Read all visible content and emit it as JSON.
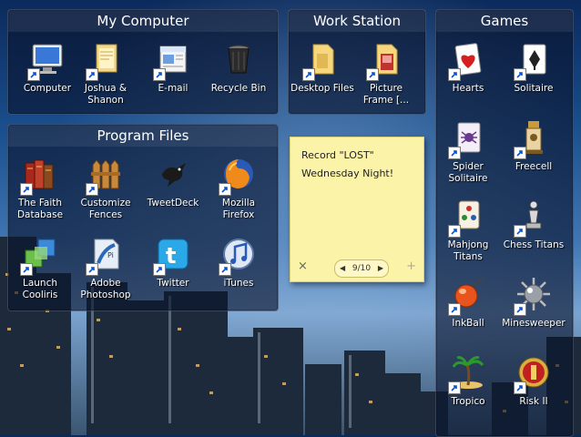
{
  "fences": {
    "my_computer": {
      "title": "My Computer",
      "items": [
        {
          "label": "Computer",
          "icon": "computer-icon"
        },
        {
          "label": "Joshua & Shanon",
          "icon": "user-folder-icon"
        },
        {
          "label": "E-mail",
          "icon": "email-icon"
        },
        {
          "label": "Recycle Bin",
          "icon": "recycle-bin-icon"
        }
      ]
    },
    "work_station": {
      "title": "Work Station",
      "items": [
        {
          "label": "Desktop Files",
          "icon": "folder-icon"
        },
        {
          "label": "Picture Frame [...",
          "icon": "picture-folder-icon"
        }
      ]
    },
    "games": {
      "title": "Games",
      "items": [
        {
          "label": "Hearts",
          "icon": "hearts-icon"
        },
        {
          "label": "Solitaire",
          "icon": "solitaire-icon"
        },
        {
          "label": "Spider Solitaire",
          "icon": "spider-solitaire-icon"
        },
        {
          "label": "Freecell",
          "icon": "freecell-icon"
        },
        {
          "label": "Mahjong Titans",
          "icon": "mahjong-icon"
        },
        {
          "label": "Chess Titans",
          "icon": "chess-icon"
        },
        {
          "label": "InkBall",
          "icon": "inkball-icon"
        },
        {
          "label": "Minesweeper",
          "icon": "minesweeper-icon"
        },
        {
          "label": "Tropico",
          "icon": "tropico-icon"
        },
        {
          "label": "Risk II",
          "icon": "risk-icon"
        }
      ]
    },
    "program_files": {
      "title": "Program Files",
      "items": [
        {
          "label": "The Faith Database",
          "icon": "books-icon"
        },
        {
          "label": "Customize Fences",
          "icon": "fences-icon"
        },
        {
          "label": "TweetDeck",
          "icon": "tweetdeck-icon"
        },
        {
          "label": "Mozilla Firefox",
          "icon": "firefox-icon"
        },
        {
          "label": "Launch Cooliris",
          "icon": "cooliris-icon"
        },
        {
          "label": "Adobe Photoshop",
          "icon": "photoshop-icon"
        },
        {
          "label": "Twitter",
          "icon": "twitter-icon"
        },
        {
          "label": "iTunes",
          "icon": "itunes-icon"
        }
      ]
    }
  },
  "sticky_note": {
    "line1": "Record \"LOST\"",
    "line2": "Wednesday Night!",
    "pager": "9/10",
    "close": "×",
    "add": "+",
    "prev": "◀",
    "next": "▶"
  }
}
